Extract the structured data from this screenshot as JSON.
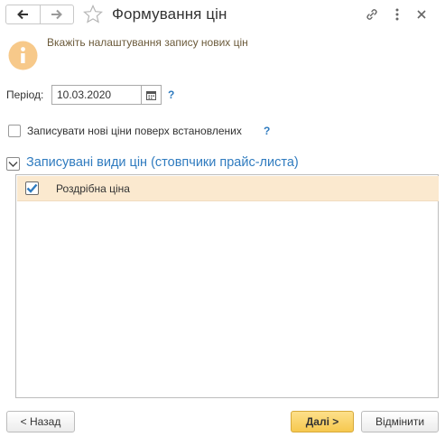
{
  "header": {
    "title": "Формування цін",
    "back_icon": "arrow-left-icon",
    "forward_icon": "arrow-right-icon",
    "favorite_icon": "star-icon",
    "link_icon": "link-icon",
    "more_icon": "more-vertical-icon",
    "close_icon": "close-icon"
  },
  "info": {
    "icon": "info-icon",
    "text": "Вкажіть налаштування запису нових цін"
  },
  "period": {
    "label": "Період:",
    "value": "10.03.2020",
    "help": "?"
  },
  "overwrite": {
    "label": "Записувати нові ціни поверх встановлених",
    "checked": false,
    "help": "?"
  },
  "price_types": {
    "title": "Записувані види цін (стовпчики прайс-листа)",
    "rows": [
      {
        "label": "Роздрібна ціна",
        "checked": true
      }
    ]
  },
  "footer": {
    "back_label": "< Назад",
    "next_label": "Далі >",
    "cancel_label": "Відмінити"
  },
  "colors": {
    "accent_blue": "#2f7bbf",
    "row_highlight": "#fbe9cf",
    "primary_button": "#f6c84f",
    "info_icon": "#f7c98a"
  }
}
